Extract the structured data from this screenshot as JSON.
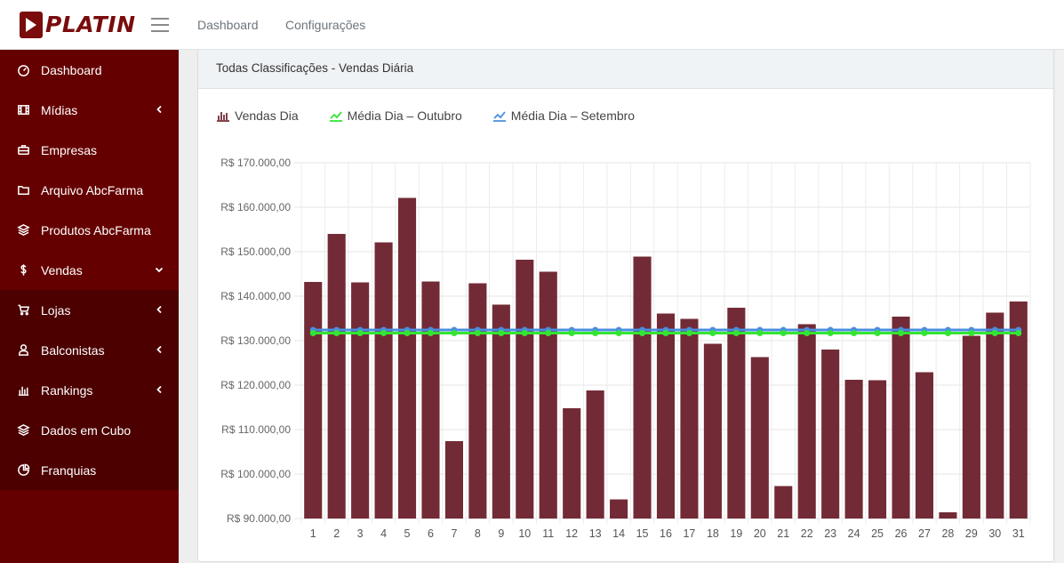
{
  "brand": {
    "name": "PLATIN"
  },
  "topnav": {
    "links": [
      "Dashboard",
      "Configurações"
    ]
  },
  "sidebar": {
    "items": [
      {
        "label": "Dashboard",
        "icon": "dashboard-icon",
        "chevron": ""
      },
      {
        "label": "Mídias",
        "icon": "film-icon",
        "chevron": "left"
      },
      {
        "label": "Empresas",
        "icon": "briefcase-icon",
        "chevron": ""
      },
      {
        "label": "Arquivo AbcFarma",
        "icon": "folder-icon",
        "chevron": ""
      },
      {
        "label": "Produtos AbcFarma",
        "icon": "layers-icon",
        "chevron": ""
      },
      {
        "label": "Vendas",
        "icon": "dollar-icon",
        "chevron": "down"
      }
    ],
    "subitems": [
      {
        "label": "Lojas",
        "icon": "cart-icon",
        "chevron": "left"
      },
      {
        "label": "Balconistas",
        "icon": "user-icon",
        "chevron": "left"
      },
      {
        "label": "Rankings",
        "icon": "bar-chart-icon",
        "chevron": "left"
      },
      {
        "label": "Dados em Cubo",
        "icon": "layers-icon",
        "chevron": ""
      },
      {
        "label": "Franquias",
        "icon": "pie-icon",
        "chevron": ""
      }
    ]
  },
  "card": {
    "title": "Todas Classificações - Vendas Diária"
  },
  "chart_data": {
    "type": "bar",
    "categories": [
      "1",
      "2",
      "3",
      "4",
      "5",
      "6",
      "7",
      "8",
      "9",
      "10",
      "11",
      "12",
      "13",
      "14",
      "15",
      "16",
      "17",
      "18",
      "19",
      "20",
      "21",
      "22",
      "23",
      "24",
      "25",
      "26",
      "27",
      "28",
      "29",
      "30",
      "31"
    ],
    "series": [
      {
        "name": "Vendas Dia",
        "type": "bar",
        "color": "#722b36",
        "values": [
          143200,
          154000,
          143100,
          152100,
          162100,
          143300,
          107400,
          142900,
          138100,
          148200,
          145500,
          114800,
          118800,
          94300,
          148900,
          136100,
          134900,
          129300,
          137400,
          126300,
          97300,
          133700,
          128000,
          121200,
          121100,
          135400,
          122900,
          91400,
          131100,
          136300,
          138800
        ]
      },
      {
        "name": "Média Dia – Outubro",
        "type": "line",
        "color": "#33e533",
        "values": [
          131700,
          131700,
          131700,
          131700,
          131700,
          131700,
          131700,
          131700,
          131700,
          131700,
          131700,
          131700,
          131700,
          131700,
          131700,
          131700,
          131700,
          131700,
          131700,
          131700,
          131700,
          131700,
          131700,
          131700,
          131700,
          131700,
          131700,
          131700,
          131700,
          131700,
          131700
        ]
      },
      {
        "name": "Média Dia – Setembro",
        "type": "line",
        "color": "#4a8de0",
        "values": [
          132400,
          132400,
          132400,
          132400,
          132400,
          132400,
          132400,
          132400,
          132400,
          132400,
          132400,
          132400,
          132400,
          132400,
          132400,
          132400,
          132400,
          132400,
          132400,
          132400,
          132400,
          132400,
          132400,
          132400,
          132400,
          132400,
          132400,
          132400,
          132400,
          132400,
          132400
        ]
      }
    ],
    "yticks": [
      "R$ 90.000,00",
      "R$ 100.000,00",
      "R$ 110.000,00",
      "R$ 120.000,00",
      "R$ 130.000,00",
      "R$ 140.000,00",
      "R$ 150.000,00",
      "R$ 160.000,00",
      "R$ 170.000,00"
    ],
    "ylim": [
      90000,
      170000
    ],
    "grid": true,
    "legend": "top-left"
  },
  "colors": {
    "sidebar": "#650000",
    "sidebar_active_group": "#4c0000",
    "brand": "#7a0c0c"
  }
}
